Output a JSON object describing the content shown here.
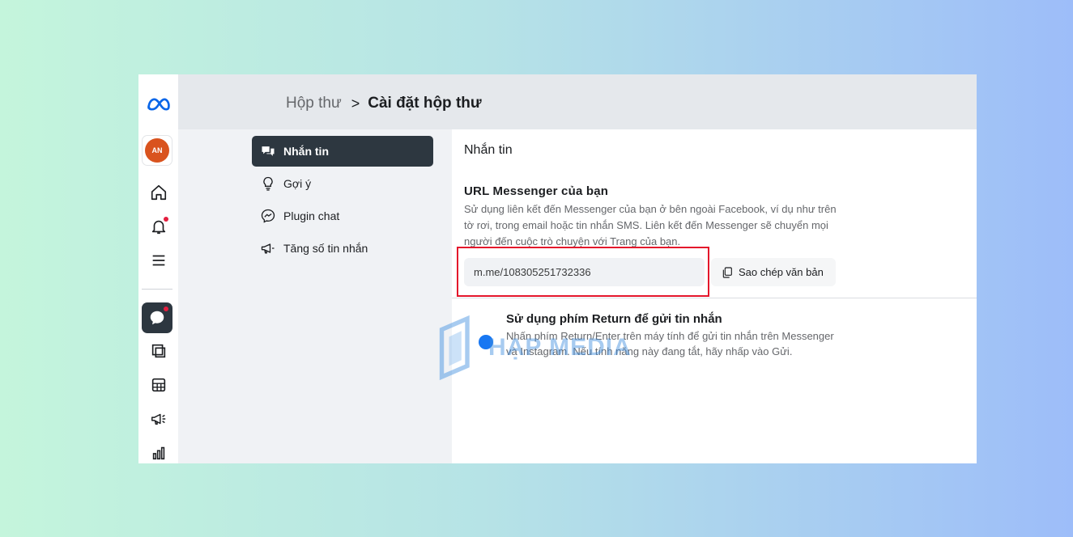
{
  "breadcrumb": {
    "parent": "Hộp thư",
    "separator": ">",
    "current": "Cài đặt hộp thư"
  },
  "rail": {
    "avatar_text": "AN",
    "icons": [
      "meta-logo-icon",
      "home-icon",
      "bell-icon",
      "menu-icon",
      "chat-icon",
      "pages-icon",
      "table-icon",
      "megaphone-icon",
      "bar-chart-icon"
    ]
  },
  "submenu": [
    {
      "label": "Nhắn tin",
      "icon": "chat-bubbles-icon",
      "active": true
    },
    {
      "label": "Gợi ý",
      "icon": "lightbulb-icon",
      "active": false
    },
    {
      "label": "Plugin chat",
      "icon": "messenger-icon",
      "active": false
    },
    {
      "label": "Tăng số tin nhắn",
      "icon": "megaphone-icon",
      "active": false
    }
  ],
  "panel": {
    "title": "Nhắn tin",
    "url_section": {
      "title": "URL Messenger của bạn",
      "description": "Sử dụng liên kết đến Messenger của bạn ở bên ngoài Facebook, ví dụ như trên tờ rơi, trong email hoặc tin nhắn SMS. Liên kết đến Messenger sẽ chuyển mọi người đến cuộc trò chuyện với Trang của bạn.",
      "url_value": "m.me/108305251732336",
      "copy_label": "Sao chép văn bản"
    },
    "return_section": {
      "title": "Sử dụng phím Return để gửi tin nhắn",
      "description": "Nhấn phím Return/Enter trên máy tính để gửi tin nhắn trên Messenger và Instagram. Nếu tính năng này đang tắt, hãy nhấp vào Gửi."
    }
  },
  "watermark": "HẠP MEDIA",
  "colors": {
    "highlight": "#e4162b",
    "accent": "#1877f2",
    "active_bg": "#2d3740"
  }
}
